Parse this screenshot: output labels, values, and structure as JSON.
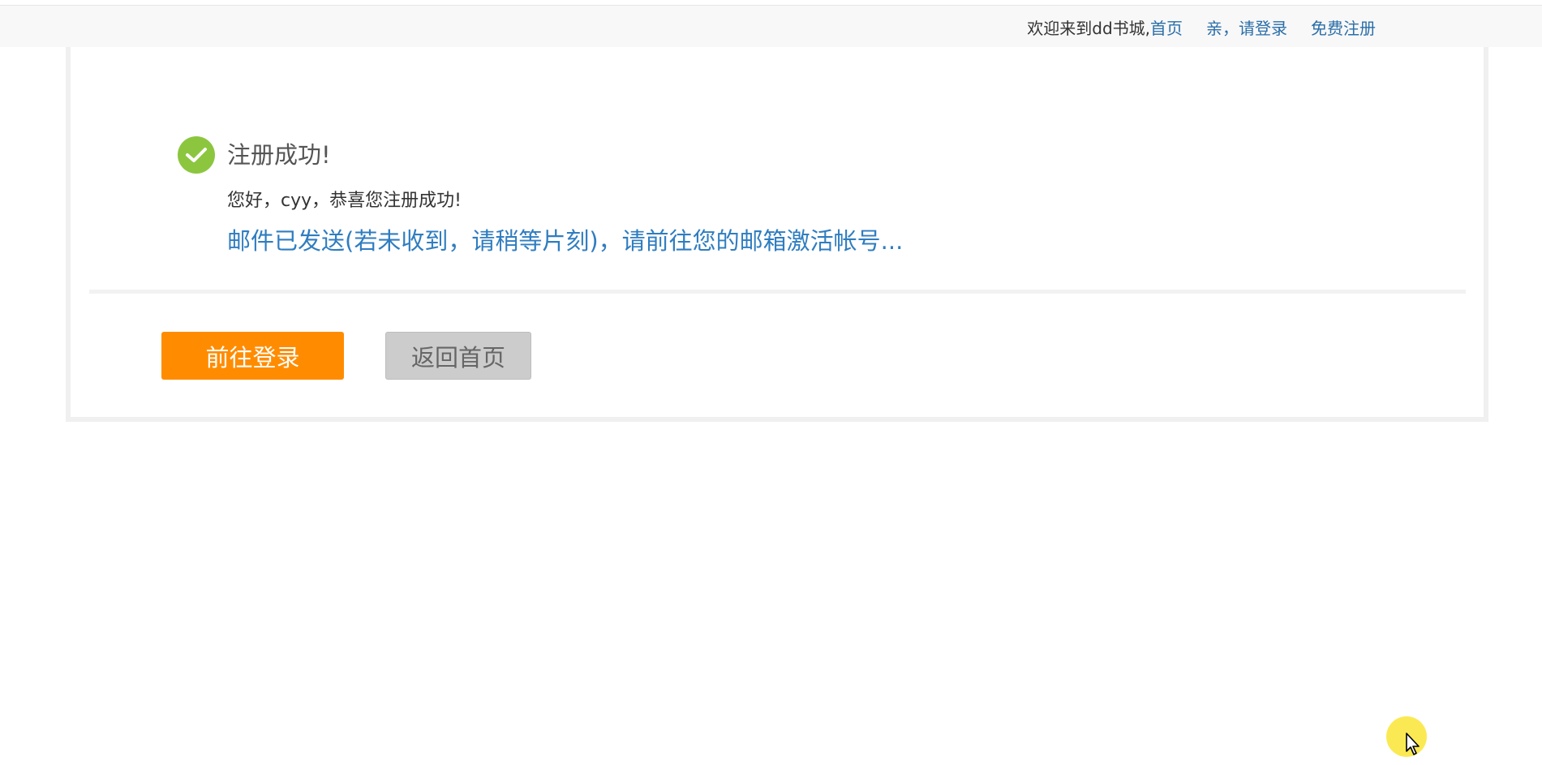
{
  "header": {
    "welcome_text": "欢迎来到dd书城,",
    "home_link": "首页",
    "login_link": "亲，请登录",
    "register_link": "免费注册"
  },
  "result": {
    "icon": "check-circle-icon",
    "title": "注册成功!",
    "greeting": "您好，cyy，恭喜您注册成功!",
    "mail_notice": "邮件已发送(若未收到，请稍等片刻)，请前往您的邮箱激活帐号..."
  },
  "actions": {
    "login_button": "前往登录",
    "home_button": "返回首页"
  },
  "colors": {
    "accent_orange": "#ff8c00",
    "link_blue": "#2a6ea8",
    "success_green": "#8cc63f",
    "secondary_gray": "#cccccc"
  }
}
